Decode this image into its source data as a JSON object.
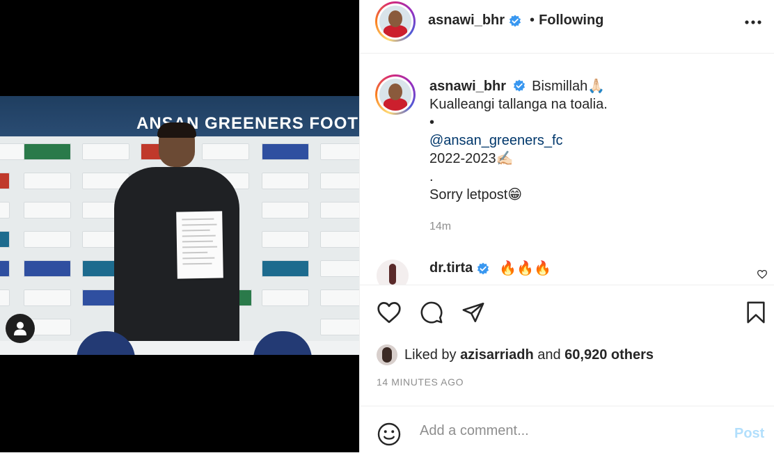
{
  "media": {
    "banner_text": "ANSAN GREENERS FOOTB"
  },
  "header": {
    "username": "asnawi_bhr",
    "separator": "•",
    "follow_state": "Following"
  },
  "caption": {
    "username": "asnawi_bhr",
    "lines": [
      "Bismillah🙏🏻",
      "Kualleangi tallanga na toalia.",
      "•",
      "@ansan_greeners_fc",
      "2022-2023✍🏻",
      ".",
      "Sorry letpost😁"
    ],
    "time": "14m"
  },
  "comment": {
    "username": "dr.tirta",
    "text": "🔥🔥🔥"
  },
  "likes": {
    "prefix": "Liked by",
    "liker": "azisarriadh",
    "conjunction": "and",
    "others": "60,920 others"
  },
  "timestamp": "14 MINUTES AGO",
  "comment_box": {
    "placeholder": "Add a comment...",
    "post_label": "Post"
  },
  "colors": {
    "verified": "#3897f0",
    "mention": "#00376b",
    "post_disabled": "#b2dffc",
    "muted": "#8e8e8e"
  },
  "icons": [
    "user-icon",
    "verified-badge-icon",
    "more-options-icon",
    "heart-icon",
    "comment-icon",
    "share-icon",
    "bookmark-icon",
    "emoji-icon",
    "small-heart-icon"
  ]
}
